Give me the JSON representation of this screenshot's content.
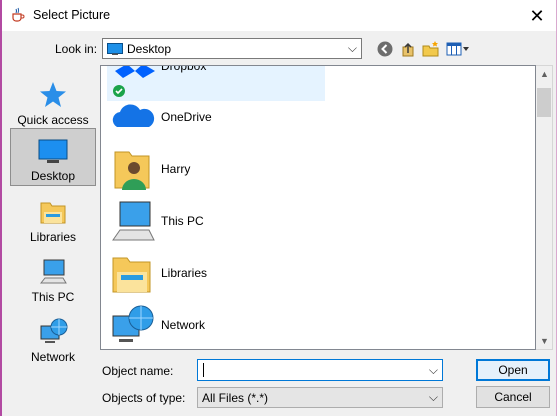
{
  "window": {
    "title": "Select Picture",
    "close_glyph": "✕",
    "title_icon": "java-cup-icon"
  },
  "lookin": {
    "label": "Look in:",
    "value": "Desktop",
    "arrow": "⌵"
  },
  "toolbar": {
    "buttons": [
      "back-icon",
      "up-folder-icon",
      "new-folder-icon",
      "view-menu-icon"
    ]
  },
  "places": [
    {
      "label": "Quick access",
      "icon": "star-icon",
      "selected": false
    },
    {
      "label": "Desktop",
      "icon": "desktop-icon",
      "selected": true
    },
    {
      "label": "Libraries",
      "icon": "libraries-icon",
      "selected": false
    },
    {
      "label": "This PC",
      "icon": "computer-icon",
      "selected": false
    },
    {
      "label": "Network",
      "icon": "network-icon",
      "selected": false
    }
  ],
  "files": [
    {
      "label": "Dropbox",
      "icon": "dropbox-icon"
    },
    {
      "label": "OneDrive",
      "icon": "onedrive-icon"
    },
    {
      "label": "Harry",
      "icon": "user-folder-icon"
    },
    {
      "label": "This PC",
      "icon": "computer-icon"
    },
    {
      "label": "Libraries",
      "icon": "libraries-icon"
    },
    {
      "label": "Network",
      "icon": "network-icon"
    }
  ],
  "form": {
    "name_label": "Object name:",
    "name_value": "",
    "type_label": "Objects of type:",
    "type_value": "All Files (*.*)",
    "open_label": "Open",
    "cancel_label": "Cancel"
  },
  "colors": {
    "accent": "#0078d7",
    "selection": "#e5f3ff",
    "place_selected": "#cfcfcf"
  }
}
